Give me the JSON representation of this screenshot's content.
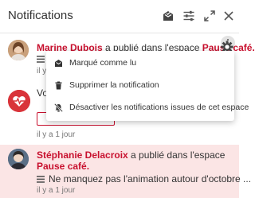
{
  "header": {
    "title": "Notifications",
    "icons": [
      "mark-all-read-icon",
      "settings-sliders-icon",
      "expand-icon",
      "close-icon"
    ]
  },
  "notifications": [
    {
      "author": "Marine Dubois",
      "action": " a publié dans l'espace ",
      "space": "Pause café.",
      "time": "il y a 1 jour",
      "avatar": "user-avatar"
    },
    {
      "author_partial": "Vo",
      "time": "il y a 1 jour",
      "icon": "heart-pulse-icon"
    },
    {
      "author": "Stéphanie Delacroix",
      "action": " a publié dans l'espace",
      "space": "Pause café.",
      "excerpt": "Ne manquez pas l'animation autour d'octobre ...",
      "time": "il y a 1 jour",
      "avatar": "user-avatar"
    }
  ],
  "menu": {
    "items": [
      {
        "label": "Marqué comme lu",
        "icon": "mark-read-icon"
      },
      {
        "label": "Supprimer la notification",
        "icon": "trash-icon"
      },
      {
        "label": "Désactiver les notifications issues de cet espace",
        "icon": "bell-slash-icon"
      }
    ]
  },
  "colors": {
    "accent": "#c8102e",
    "unread_background": "#fbe5e5",
    "app_icon": "#d9343a"
  }
}
